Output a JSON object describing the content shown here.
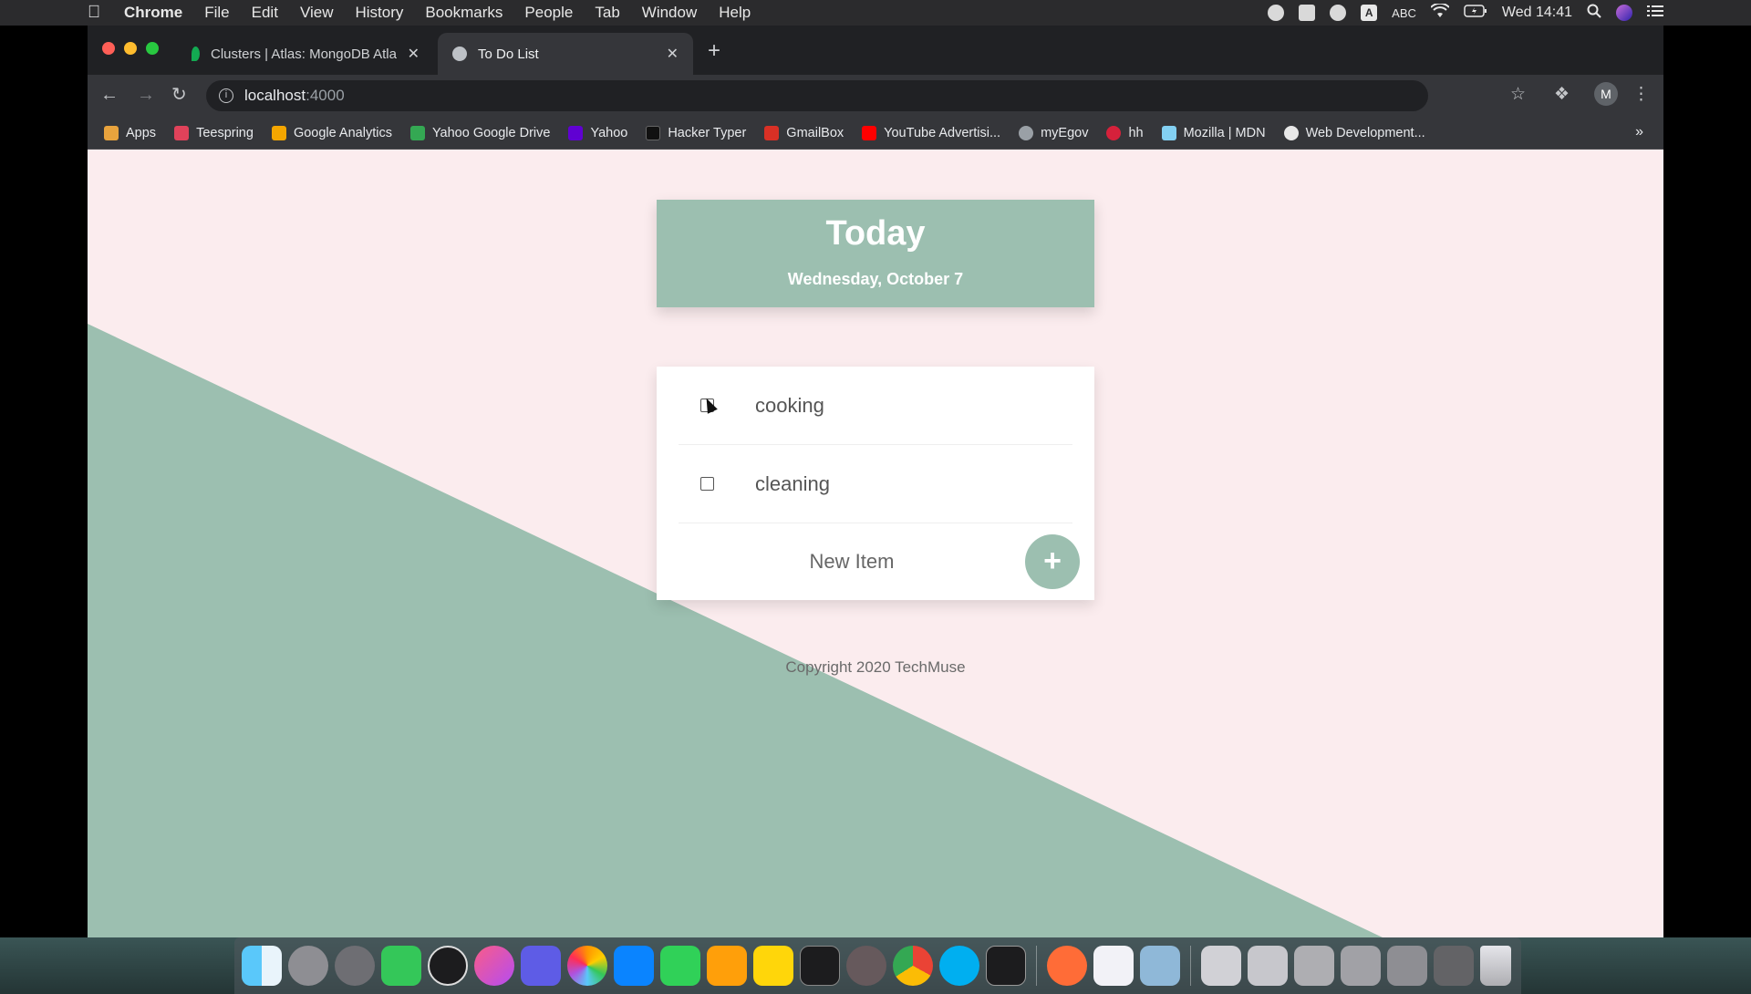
{
  "menubar": {
    "app_name": "Chrome",
    "menus": [
      "File",
      "Edit",
      "View",
      "History",
      "Bookmarks",
      "People",
      "Tab",
      "Window",
      "Help"
    ],
    "input_source": "ABC",
    "clock": "Wed 14:41"
  },
  "browser": {
    "tabs": [
      {
        "title": "Clusters | Atlas: MongoDB Atla",
        "favicon": "mongodb-leaf-icon",
        "active": false
      },
      {
        "title": "To Do List",
        "favicon": "globe-icon",
        "active": true
      }
    ],
    "url_host": "localhost",
    "url_port": ":4000",
    "profile_initial": "M",
    "bookmarks": [
      {
        "label": "Apps",
        "icon": "apps-grid-icon",
        "color": "#e8a33d"
      },
      {
        "label": "Teespring",
        "icon": "teespring-icon",
        "color": "#e0425a"
      },
      {
        "label": "Google Analytics",
        "icon": "analytics-icon",
        "color": "#f4a600"
      },
      {
        "label": "Yahoo Google Drive",
        "icon": "drive-icon",
        "color": "#34a853"
      },
      {
        "label": "Yahoo",
        "icon": "yahoo-icon",
        "color": "#6001d2"
      },
      {
        "label": "Hacker Typer",
        "icon": "terminal-icon",
        "color": "#111111"
      },
      {
        "label": "GmailBox",
        "icon": "gmail-icon",
        "color": "#d93025"
      },
      {
        "label": "YouTube Advertisi...",
        "icon": "youtube-icon",
        "color": "#ff0000"
      },
      {
        "label": "myEgov",
        "icon": "egov-icon",
        "color": "#9aa0a6"
      },
      {
        "label": "hh",
        "icon": "hh-icon",
        "color": "#d6213b"
      },
      {
        "label": "Mozilla | MDN",
        "icon": "mdn-icon",
        "color": "#83d0f2"
      },
      {
        "label": "Web Development...",
        "icon": "webdev-icon",
        "color": "#e8e8e8"
      }
    ],
    "more_bookmarks": "»"
  },
  "page": {
    "heading": "Today",
    "date": "Wednesday, October 7",
    "items": [
      {
        "text": "cooking",
        "checked": false
      },
      {
        "text": "cleaning",
        "checked": false
      }
    ],
    "new_item_placeholder": "New Item",
    "add_button_label": "+",
    "footer": "Copyright 2020 TechMuse",
    "colors": {
      "accent": "#9cbfb0",
      "background": "#fbecee"
    }
  },
  "dock": {
    "apps": [
      "finder-icon",
      "launchpad-icon",
      "system-preferences-icon",
      "facetime-icon",
      "obs-icon",
      "itunes-icon",
      "imovie-icon",
      "photos-icon",
      "keynote-icon",
      "numbers-icon",
      "pages-icon",
      "notes-icon",
      "terminal-icon",
      "atom-icon",
      "chrome-icon",
      "skype-icon",
      "activity-monitor-icon",
      "postman-icon",
      "textedit-icon",
      "preview-icon",
      "downloads-stack-icon",
      "documents-stack-icon",
      "screenshots-stack-icon",
      "desktop-stack-icon",
      "folder-stack-icon",
      "applications-stack-icon",
      "trash-icon"
    ]
  }
}
